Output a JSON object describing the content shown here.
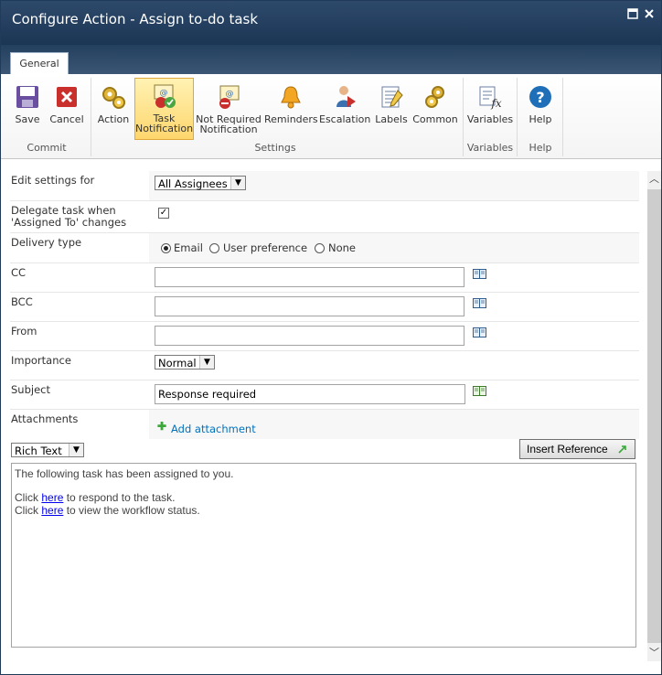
{
  "window": {
    "title": "Configure Action - Assign to-do task",
    "maximize_icon": "maximize-icon",
    "close_icon": "close-icon"
  },
  "ribbon": {
    "tab": "General",
    "buttons": {
      "save": "Save",
      "cancel": "Cancel",
      "action": "Action",
      "task_notification_1": "Task",
      "task_notification_2": "Notification",
      "not_required_1": "Not Required",
      "not_required_2": "Notification",
      "reminders": "Reminders",
      "escalation": "Escalation",
      "labels": "Labels",
      "common": "Common",
      "variables": "Variables",
      "help": "Help"
    },
    "groups": {
      "commit": "Commit",
      "settings": "Settings",
      "variables": "Variables",
      "help": "Help"
    }
  },
  "form": {
    "edit_settings_label": "Edit settings for",
    "edit_settings_value": "All Assignees",
    "delegate_label_1": "Delegate task when",
    "delegate_label_2": "'Assigned To' changes",
    "delegate_checked": true,
    "delivery_label": "Delivery type",
    "delivery_options": [
      "Email",
      "User preference",
      "None"
    ],
    "delivery_selected": "Email",
    "cc_label": "CC",
    "cc_value": "",
    "bcc_label": "BCC",
    "bcc_value": "",
    "from_label": "From",
    "from_value": "",
    "importance_label": "Importance",
    "importance_value": "Normal",
    "subject_label": "Subject",
    "subject_value": "Response required",
    "attachments_label": "Attachments",
    "add_attachment": "Add attachment"
  },
  "editor": {
    "format_value": "Rich Text",
    "insert_reference": "Insert Reference",
    "line1": "The following task has been assigned to you.",
    "click1": "Click ",
    "here1": "here",
    "rest1": " to respond to the task.",
    "click2": "Click ",
    "here2": "here",
    "rest2": " to view the workflow status."
  },
  "colors": {
    "titlebar": "#1b3554",
    "active_button": "#fed66d",
    "link": "#0072bc"
  }
}
